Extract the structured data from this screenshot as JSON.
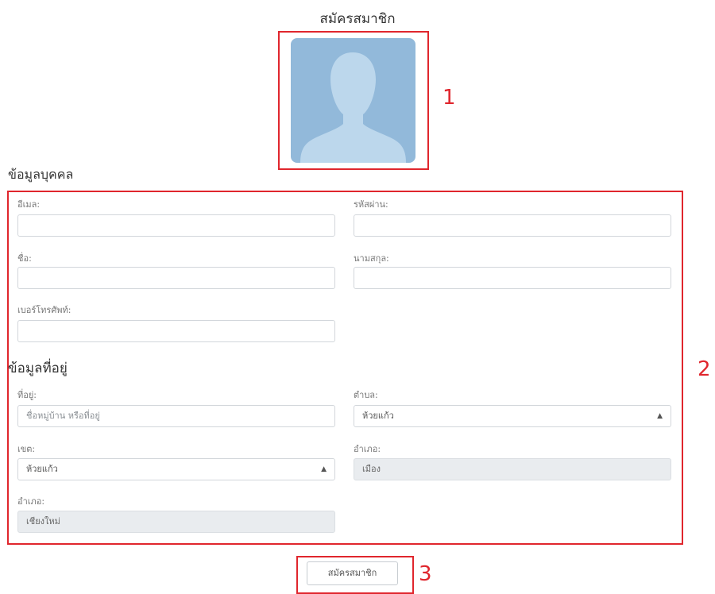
{
  "page": {
    "title": "สมัครสมาชิก"
  },
  "annotations": {
    "one": "1",
    "two": "2",
    "three": "3"
  },
  "personal": {
    "heading": "ข้อมูลบุคคล",
    "email_label": "อีเมล:",
    "password_label": "รหัสผ่าน:",
    "firstname_label": "ชื่อ:",
    "lastname_label": "นามสกุล:",
    "phone_label": "เบอร์โทรศัพท์:",
    "email_value": "",
    "password_value": "",
    "firstname_value": "",
    "lastname_value": "",
    "phone_value": ""
  },
  "address": {
    "heading": "ข้อมูลที่อยู่",
    "address_label": "ที่อยู่:",
    "address_placeholder": "ชื่อหมู่บ้าน หรือที่อยู่",
    "subdistrict_label": "ตำบล:",
    "subdistrict_value": "ห้วยแก้ว",
    "district_label": "เขต:",
    "district_value": "ห้วยแก้ว",
    "amphoe_label": "อำเภอ:",
    "amphoe_value": "เมือง",
    "province_label": "อำเภอ:",
    "province_value": "เชียงใหม่"
  },
  "actions": {
    "submit_label": "สมัครสมาชิก"
  },
  "icons": {
    "avatar": "person-silhouette-icon",
    "select_caret": "updown-caret-icon"
  },
  "colors": {
    "annotation": "#e0262d",
    "avatar_bg": "#92b9da",
    "avatar_figure": "#bcd7ec",
    "disabled_bg": "#e9ecef"
  }
}
